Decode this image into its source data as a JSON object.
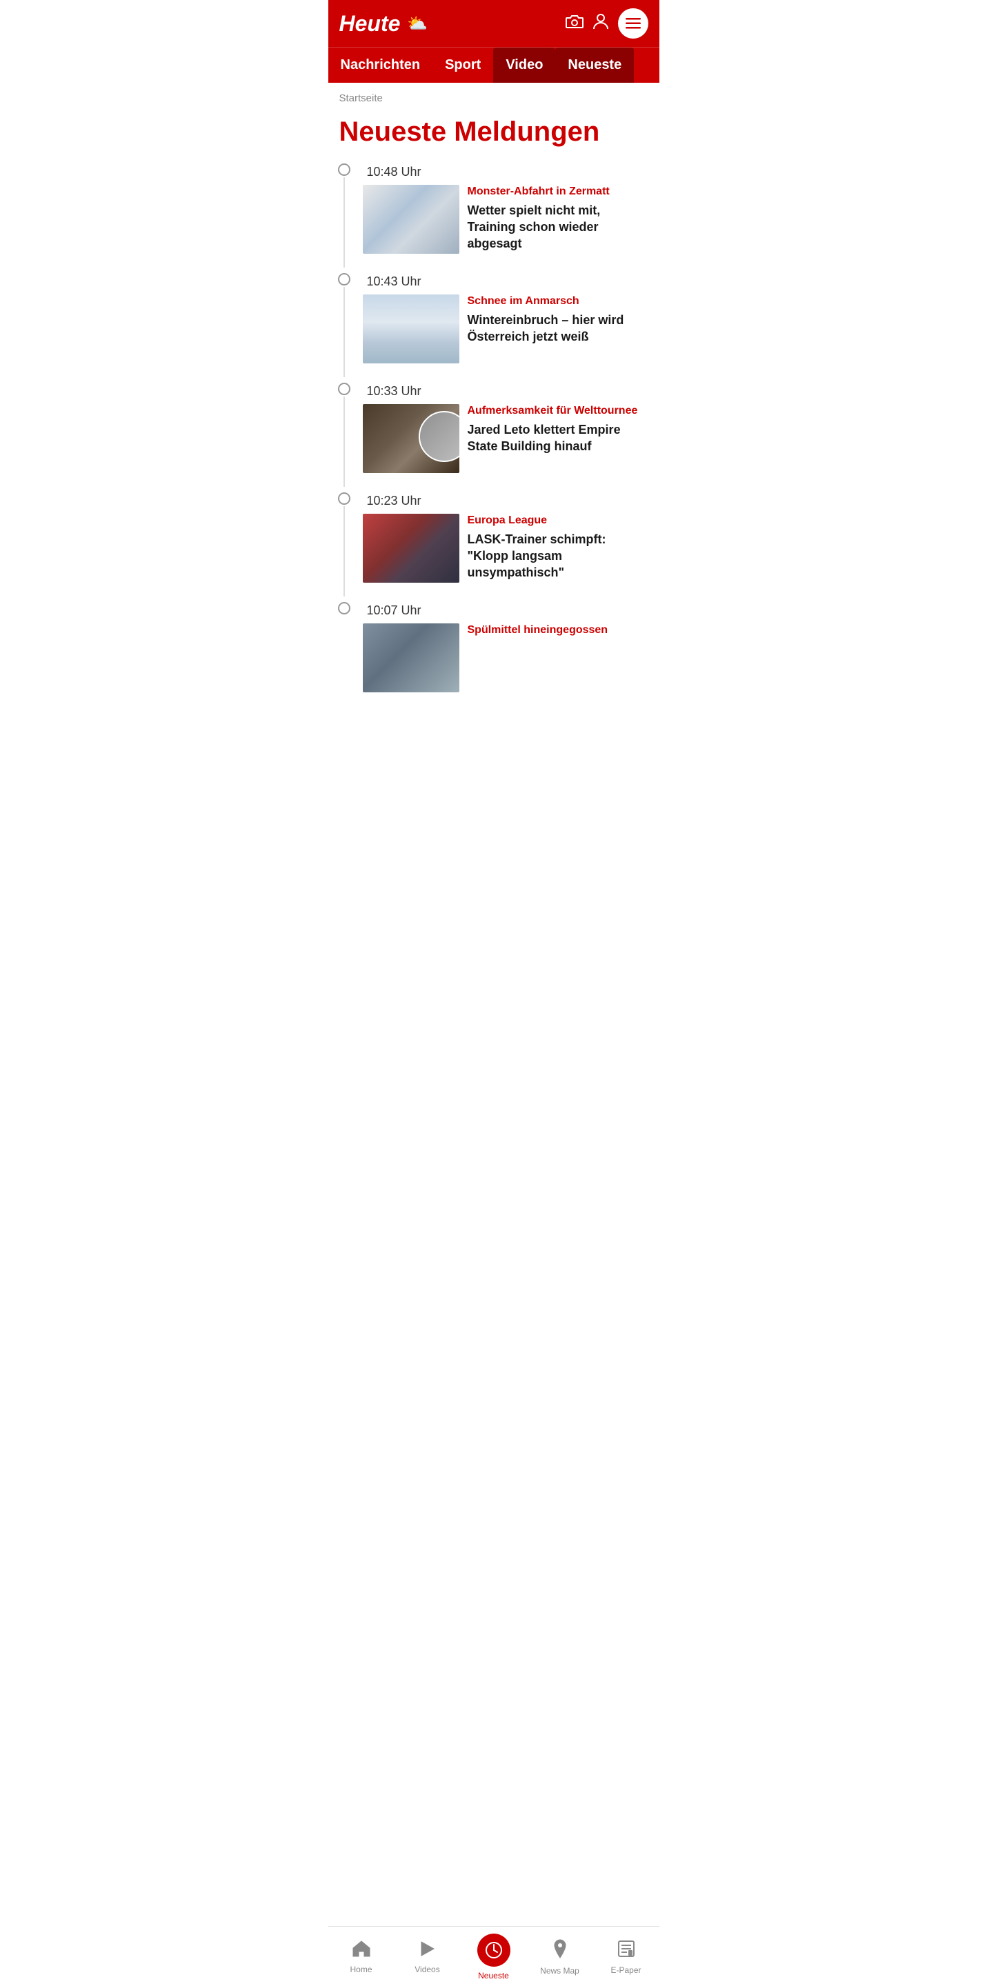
{
  "header": {
    "logo": "Heute",
    "icons": {
      "camera": "📷",
      "user": "👤",
      "menu": "☰"
    }
  },
  "navbar": {
    "items": [
      {
        "id": "nachrichten",
        "label": "Nachrichten",
        "active": false
      },
      {
        "id": "sport",
        "label": "Sport",
        "active": false
      },
      {
        "id": "video",
        "label": "Video",
        "active": true
      },
      {
        "id": "neueste",
        "label": "Neueste",
        "active": true
      }
    ]
  },
  "breadcrumb": "Startseite",
  "page_title": "Neueste Meldungen",
  "news_items": [
    {
      "time": "10:48 Uhr",
      "category": "Monster-Abfahrt in Zermatt",
      "headline": "Wetter spielt nicht mit, Training schon wieder abgesagt",
      "thumb_class": "thumb-zermatt"
    },
    {
      "time": "10:43 Uhr",
      "category": "Schnee im Anmarsch",
      "headline": "Wintereinbruch – hier wird Österreich jetzt weiß",
      "thumb_class": "thumb-snow"
    },
    {
      "time": "10:33 Uhr",
      "category": "Aufmerksamkeit für Welttournee",
      "headline": "Jared Leto klettert Empire State Building hinauf",
      "thumb_class": "thumb-jared"
    },
    {
      "time": "10:23 Uhr",
      "category": "Europa League",
      "headline": "LASK-Trainer schimpft: \"Klopp langsam unsympathisch\"",
      "thumb_class": "thumb-lask"
    },
    {
      "time": "10:07 Uhr",
      "category": "Spülmittel hineingegossen",
      "headline": "",
      "thumb_class": "thumb-spul"
    }
  ],
  "bottom_nav": {
    "items": [
      {
        "id": "home",
        "label": "Home",
        "icon": "🏠",
        "active": false
      },
      {
        "id": "videos",
        "label": "Videos",
        "icon": "▶",
        "active": false
      },
      {
        "id": "neueste",
        "label": "Neueste",
        "icon": "🕐",
        "active": true
      },
      {
        "id": "newsmap",
        "label": "News Map",
        "icon": "📍",
        "active": false
      },
      {
        "id": "epaper",
        "label": "E-Paper",
        "icon": "📰",
        "active": false
      }
    ]
  }
}
